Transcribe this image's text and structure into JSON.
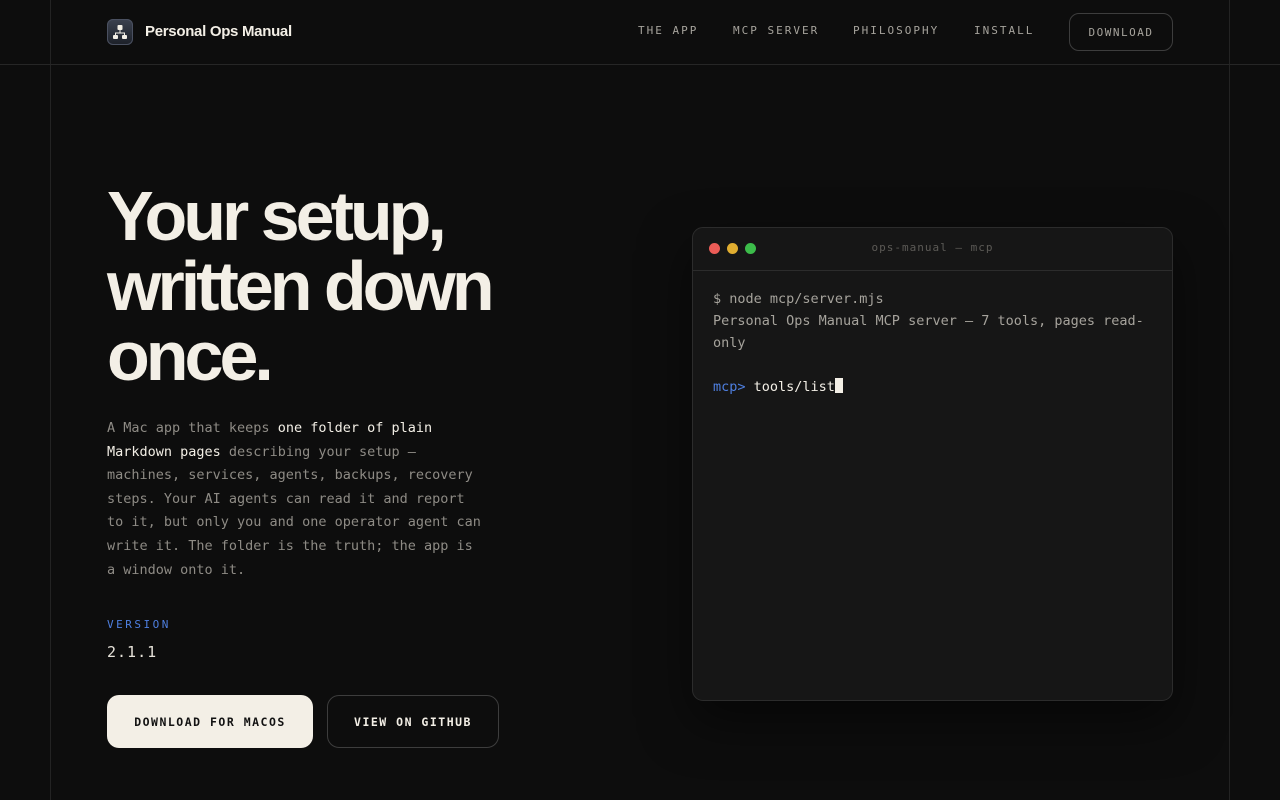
{
  "header": {
    "brand_name": "Personal Ops Manual",
    "nav": [
      "THE APP",
      "MCP SERVER",
      "PHILOSOPHY",
      "INSTALL"
    ],
    "download_label": "DOWNLOAD"
  },
  "hero": {
    "title_lines": [
      "Your setup,",
      "written down",
      "once."
    ],
    "desc": {
      "p1": "A Mac app that keeps ",
      "h1": "one folder of plain Markdown pages",
      "p2": " describing your setup — machines, services, agents, backups, recovery steps. Your AI agents can read it and report to it, but only you and one operator agent can write it. The folder is the truth; the app is a window onto it."
    },
    "version_label": "VERSION",
    "version_value": "2.1.1",
    "primary_button": "DOWNLOAD FOR MACOS",
    "secondary_button": "VIEW ON GITHUB"
  },
  "terminal": {
    "title": "ops-manual — mcp",
    "line1": "$ node mcp/server.mjs",
    "line2": "Personal Ops Manual MCP server — 7 tools, pages read-only",
    "prompt": "mcp>",
    "command": "tools/list"
  },
  "colors": {
    "background": "#0d0d0d",
    "text": "#f3efe6",
    "muted": "#8e8b85",
    "accent": "#4e7fe0"
  },
  "icons": {
    "logo": "org-chart-icon"
  }
}
